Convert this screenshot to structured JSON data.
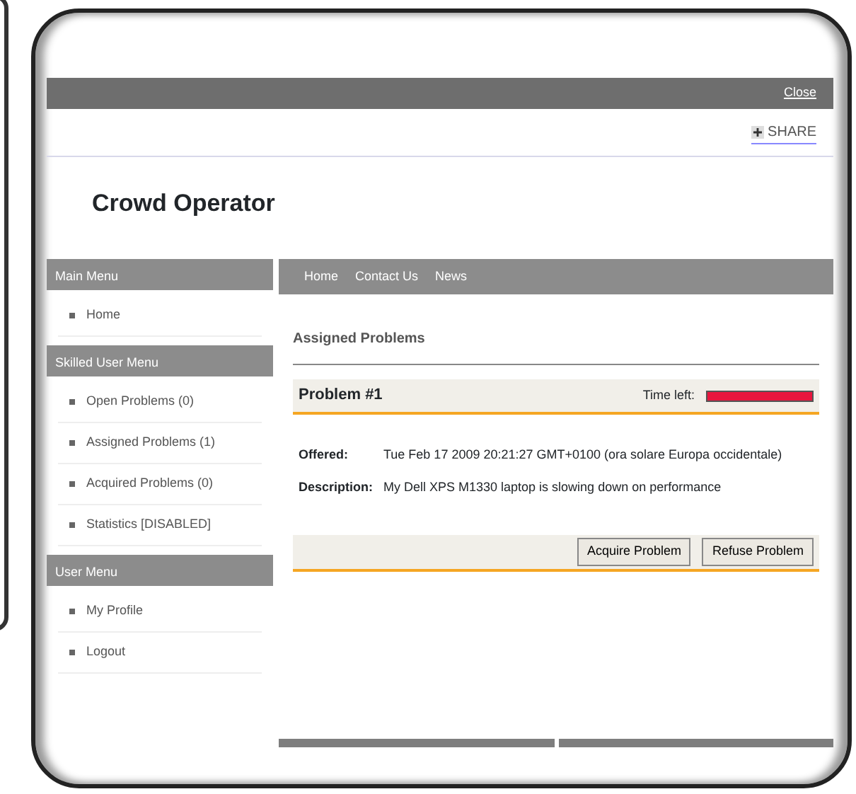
{
  "top_bar": {
    "close": "Close"
  },
  "share": {
    "label": "SHARE"
  },
  "site_title": "Crowd Operator",
  "sidebar": [
    {
      "title": "Main Menu",
      "items": [
        {
          "label": "Home"
        }
      ]
    },
    {
      "title": "Skilled User Menu",
      "items": [
        {
          "label": "Open Problems (0)"
        },
        {
          "label": "Assigned Problems (1)"
        },
        {
          "label": "Acquired Problems (0)"
        },
        {
          "label": "Statistics [DISABLED]"
        }
      ]
    },
    {
      "title": "User Menu",
      "items": [
        {
          "label": "My Profile"
        },
        {
          "label": "Logout"
        }
      ]
    }
  ],
  "nav": [
    "Home",
    "Contact Us",
    "News"
  ],
  "section_title": "Assigned Problems",
  "problem": {
    "title": "Problem #1",
    "time_left": {
      "label": "Time left:",
      "level": 1
    },
    "fields": [
      {
        "label": "Offered:",
        "value": "Tue Feb 17 2009 20:21:27 GMT+0100 (ora solare Europa occidentale)"
      },
      {
        "label": "Description:",
        "value": "My Dell XPS M1330 laptop is slowing down on performance"
      }
    ],
    "buttons": [
      "Acquire Problem",
      "Refuse Problem"
    ]
  }
}
